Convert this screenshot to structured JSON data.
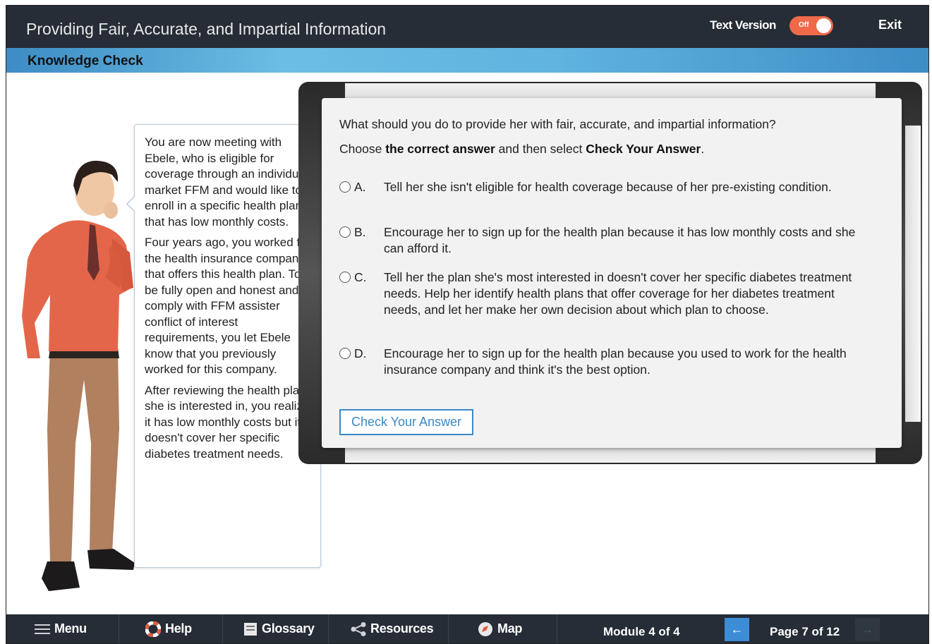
{
  "header": {
    "title": "Providing Fair, Accurate, and Impartial Information",
    "text_version_label": "Text Version",
    "toggle_state": "Off",
    "exit_label": "Exit"
  },
  "section": {
    "title": "Knowledge Check"
  },
  "scenario": {
    "paragraphs": [
      "You are now meeting with Ebele, who is eligible for coverage through an individual market FFM and would like to enroll in a specific health plan that has low monthly costs.",
      "Four years ago, you worked for the health insurance company that offers this health plan. To be fully open and honest and to comply with FFM assister conflict of interest requirements, you let Ebele know that you previously worked for this company.",
      "After reviewing the health plan she is interested in, you realize it has low monthly costs but it doesn't cover her specific diabetes treatment needs."
    ]
  },
  "quiz": {
    "question": "What should you do to provide her with fair, accurate, and impartial information?",
    "instruction_prefix": "Choose ",
    "instruction_bold1": "the correct answer",
    "instruction_mid": " and then select ",
    "instruction_bold2": "Check Your Answer",
    "instruction_suffix": ".",
    "options": [
      {
        "letter": "A.",
        "text": "Tell her she isn't eligible for health coverage because of her pre-existing condition."
      },
      {
        "letter": "B.",
        "text": "Encourage her to sign up for the health plan because it has low monthly costs and she can afford it."
      },
      {
        "letter": "C.",
        "text": "Tell her the plan she's most interested in doesn't cover her specific diabetes treatment needs. Help her identify health plans that offer coverage for her diabetes treatment needs, and let her make her own decision about which plan to choose."
      },
      {
        "letter": "D.",
        "text": "Encourage her to sign up for the health plan because you used to work for the health insurance company and think it's the best option."
      }
    ],
    "check_button": "Check Your Answer"
  },
  "footer": {
    "menu": "Menu",
    "help": "Help",
    "glossary": "Glossary",
    "resources": "Resources",
    "map": "Map",
    "module": "Module 4 of 4",
    "page": "Page 7 of 12",
    "prev_icon": "left-arrow-icon",
    "next_icon": "right-arrow-icon"
  },
  "colors": {
    "topbar": "#262d36",
    "toggle": "#f06a4a",
    "accent": "#3a8ac5"
  }
}
